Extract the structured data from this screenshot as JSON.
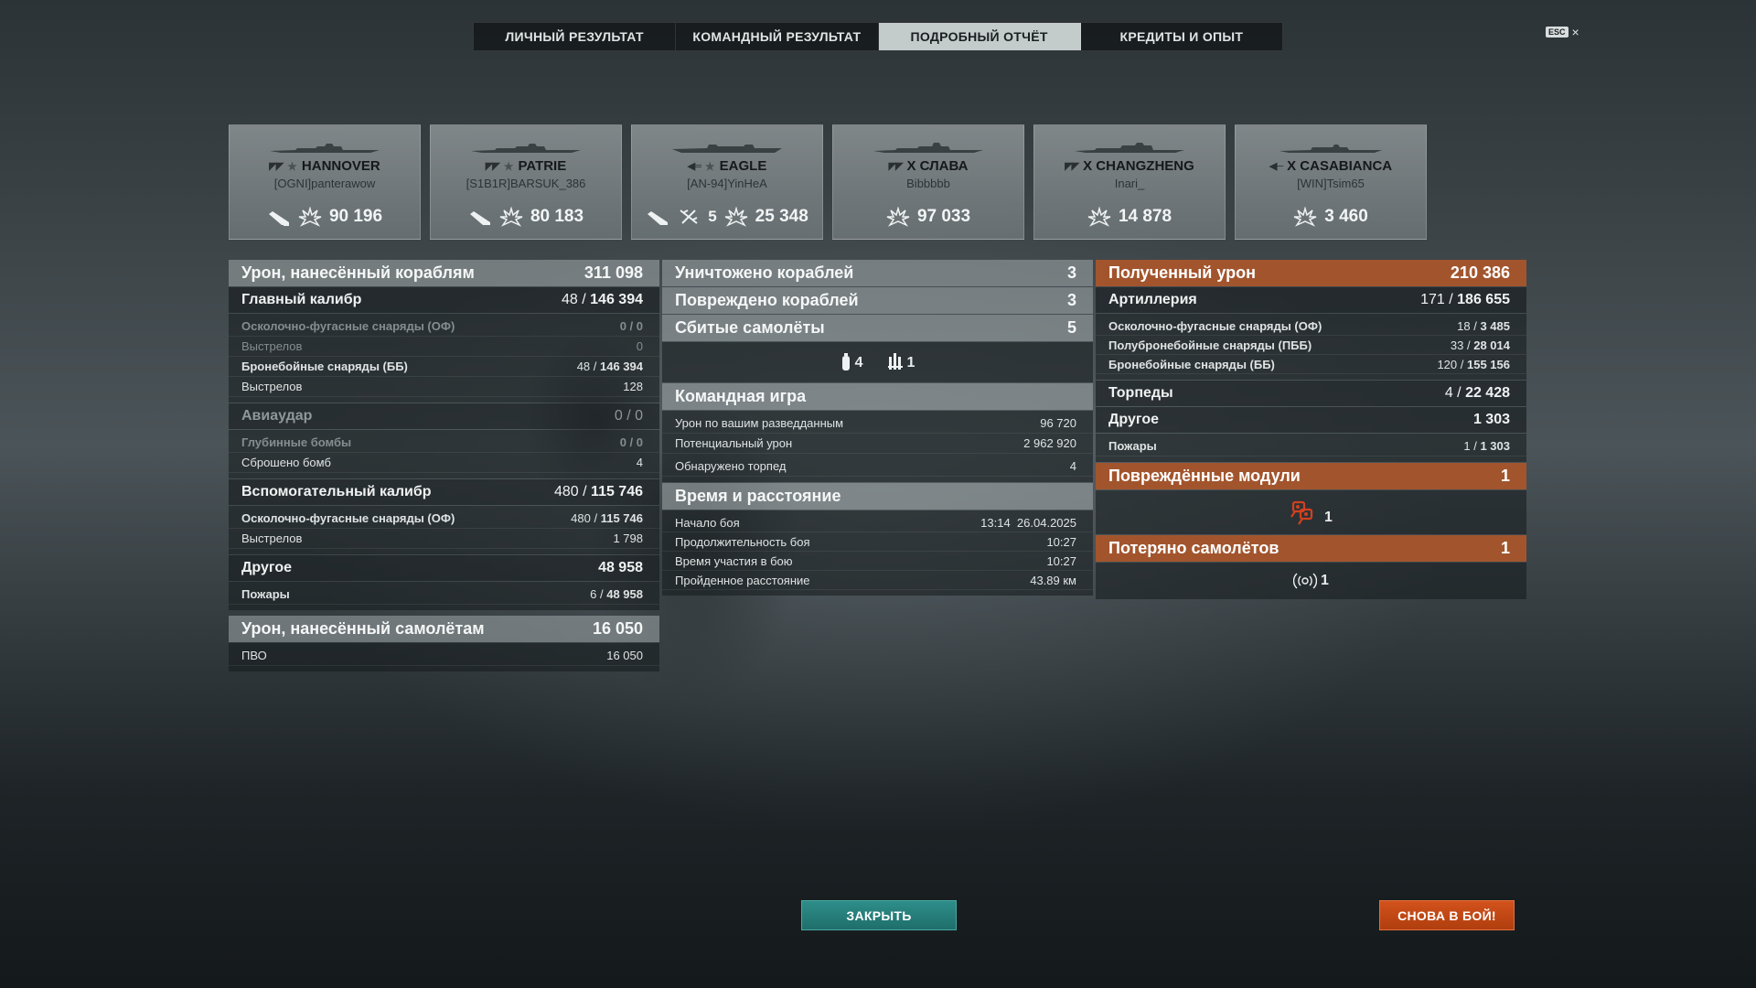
{
  "tabs": [
    {
      "label": "ЛИЧНЫЙ РЕЗУЛЬТАТ",
      "active": false
    },
    {
      "label": "КОМАНДНЫЙ РЕЗУЛЬТАТ",
      "active": false
    },
    {
      "label": "ПОДРОБНЫЙ ОТЧЁТ",
      "active": true
    },
    {
      "label": "КРЕДИТЫ И ОПЫТ",
      "active": false
    }
  ],
  "esc": {
    "key": "ESC",
    "close": "×"
  },
  "ships": [
    {
      "class_icon": "battleship-icon",
      "name": "HANNOVER",
      "player": "[OGNI]panterawow",
      "icons": [
        "ship-kill-icon",
        "damage-icon"
      ],
      "kills": "",
      "damage": "90 196"
    },
    {
      "class_icon": "battleship-icon",
      "name": "PATRIE",
      "player": "[S1B1R]BARSUK_386",
      "icons": [
        "ship-kill-icon",
        "damage-icon"
      ],
      "kills": "",
      "damage": "80 183"
    },
    {
      "class_icon": "cruiser-icon",
      "name": "EAGLE",
      "player": "[AN-94]YinHeA",
      "icons": [
        "ship-kill-icon",
        "plane-kill-icon",
        "damage-icon"
      ],
      "kills": "5",
      "damage": "25 348"
    },
    {
      "class_icon": "battleship-icon",
      "name": "X СЛАВА",
      "player": "Bibbbbb",
      "icons": [
        "damage-icon"
      ],
      "kills": "",
      "damage": "97 033"
    },
    {
      "class_icon": "battleship-icon",
      "name": "X CHANGZHENG",
      "player": "Inari_",
      "icons": [
        "damage-icon"
      ],
      "kills": "",
      "damage": "14 878"
    },
    {
      "class_icon": "destroyer-icon",
      "name": "X CASABIANCA",
      "player": "[WIN]Tsim65",
      "icons": [
        "damage-icon"
      ],
      "kills": "",
      "damage": "3 460"
    }
  ],
  "left": {
    "ship_damage": {
      "label": "Урон, нанесённый кораблям",
      "value": "311 098"
    },
    "main_battery": {
      "label": "Главный калибр",
      "hits": "48",
      "value": "146 394"
    },
    "main_rows": [
      {
        "label": "Осколочно-фугасные снаряды (ОФ)",
        "hits": "0",
        "value": "0",
        "dim": true,
        "bold": true
      },
      {
        "label": "Выстрелов",
        "hits": "",
        "value": "0",
        "dim": true,
        "bold": false
      },
      {
        "label": "Бронебойные снаряды (ББ)",
        "hits": "48",
        "value": "146 394",
        "dim": false,
        "bold": true
      },
      {
        "label": "Выстрелов",
        "hits": "",
        "value": "128",
        "dim": false,
        "bold": false
      }
    ],
    "air_strike": {
      "label": "Авиаудар",
      "hits": "0",
      "value": "0"
    },
    "air_rows": [
      {
        "label": "Глубинные бомбы",
        "hits": "0",
        "value": "0"
      },
      {
        "label": "Сброшено бомб",
        "hits": "",
        "value": "4"
      }
    ],
    "secondary": {
      "label": "Вспомогательный калибр",
      "hits": "480",
      "value": "115 746"
    },
    "secondary_rows": [
      {
        "label": "Осколочно-фугасные снаряды (ОФ)",
        "hits": "480",
        "value": "115 746"
      },
      {
        "label": "Выстрелов",
        "hits": "",
        "value": "1 798"
      }
    ],
    "other": {
      "label": "Другое",
      "value": "48 958"
    },
    "fires": {
      "label": "Пожары",
      "hits": "6",
      "value": "48 958"
    },
    "plane_damage": {
      "label": "Урон, нанесённый самолётам",
      "value": "16 050"
    },
    "aa": {
      "label": "ПВО",
      "value": "16 050"
    }
  },
  "mid": {
    "destroyed": {
      "label": "Уничтожено кораблей",
      "value": "3"
    },
    "damaged": {
      "label": "Повреждено кораблей",
      "value": "3"
    },
    "planes_shot": {
      "label": "Сбитые самолёты",
      "value": "5"
    },
    "planes_icons": [
      {
        "icon": "fighter-plane-icon",
        "count": "4"
      },
      {
        "icon": "plane-squadron-icon",
        "count": "1"
      }
    ],
    "team": {
      "label": "Командная игра"
    },
    "team_rows": [
      {
        "label": "Урон по вашим разведданным",
        "value": "96 720"
      },
      {
        "label": "Потенциальный урон",
        "value": "2 962 920"
      },
      {
        "label": "Обнаружено торпед",
        "value": "4"
      }
    ],
    "time": {
      "label": "Время и расстояние"
    },
    "time_rows": [
      {
        "label": "Начало боя",
        "value": "13:14  26.04.2025"
      },
      {
        "label": "Продолжительность боя",
        "value": "10:27"
      },
      {
        "label": "Время участия в бою",
        "value": "10:27"
      },
      {
        "label": "Пройденное расстояние",
        "value": "43.89 км"
      }
    ]
  },
  "right": {
    "received": {
      "label": "Полученный урон",
      "value": "210 386"
    },
    "artillery": {
      "label": "Артиллерия",
      "hits": "171",
      "value": "186 655"
    },
    "art_rows": [
      {
        "label": "Осколочно-фугасные снаряды (ОФ)",
        "hits": "18",
        "value": "3 485"
      },
      {
        "label": "Полубронебойные снаряды (ПББ)",
        "hits": "33",
        "value": "28 014"
      },
      {
        "label": "Бронебойные снаряды (ББ)",
        "hits": "120",
        "value": "155 156"
      }
    ],
    "torpedoes": {
      "label": "Торпеды",
      "hits": "4",
      "value": "22 428"
    },
    "other": {
      "label": "Другое",
      "value": "1 303"
    },
    "fires": {
      "label": "Пожары",
      "hits": "1",
      "value": "1 303"
    },
    "modules": {
      "label": "Повреждённые модули",
      "value": "1",
      "icon": "turret-module-icon",
      "count": "1"
    },
    "planes_lost": {
      "label": "Потеряно самолётов",
      "value": "1",
      "icon": "radar-plane-icon",
      "count": "1"
    }
  },
  "buttons": {
    "close": "ЗАКРЫТЬ",
    "again": "СНОВА В БОЙ!"
  },
  "colors": {
    "accent_orange": "#a2552d",
    "close_button": "#2e8e8a",
    "again_button": "#d2521c"
  }
}
